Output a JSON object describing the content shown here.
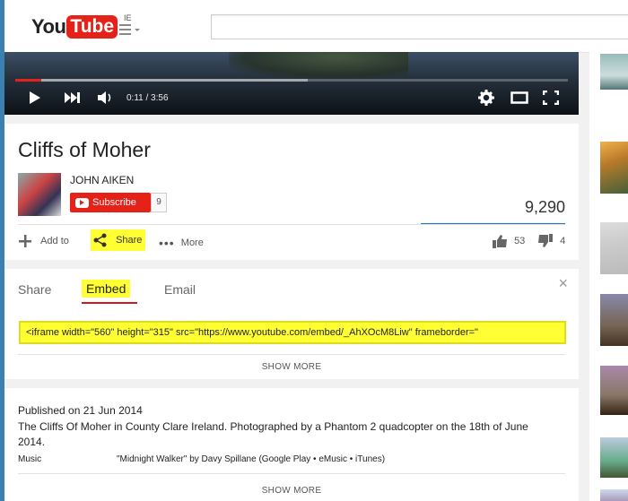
{
  "header": {
    "logo_you": "You",
    "logo_tube": "Tube",
    "region": "IE",
    "search_placeholder": ""
  },
  "player": {
    "time": "0:11 / 3:56",
    "progress": 0.047,
    "loaded": 0.53,
    "accent": "#e62117"
  },
  "video": {
    "title": "Cliffs of Moher",
    "channel": "JOHN AIKEN",
    "subscribe_label": "Subscribe",
    "subscriber_count": "9",
    "views": "9,290",
    "like_ratio": 1.0
  },
  "actions": {
    "add_to": "Add to",
    "share": "Share",
    "more": "More",
    "likes": "53",
    "dislikes": "4"
  },
  "share_panel": {
    "tabs": [
      "Share",
      "Embed",
      "Email"
    ],
    "active_tab": "Embed",
    "embed_code": "<iframe width=\"560\" height=\"315\" src=\"https://www.youtube.com/embed/_AhXOcM8Liw\" frameborder=\"",
    "show_more": "SHOW MORE"
  },
  "description": {
    "published_prefix": "Published on ",
    "published_date": "21 Jun 2014",
    "text": "The Cliffs Of Moher in County Clare Ireland. Photographed by a Phantom 2 quadcopter on the 18th of June 2014.",
    "music_label": "Music",
    "music_value": "\"Midnight Walker\" by Davy Spillane (Google Play • eMusic • iTunes)",
    "show_more": "SHOW MORE"
  },
  "colors": {
    "highlight": "#ffff33",
    "brand_red": "#e62117",
    "view_bar_blue": "#167ac6"
  }
}
